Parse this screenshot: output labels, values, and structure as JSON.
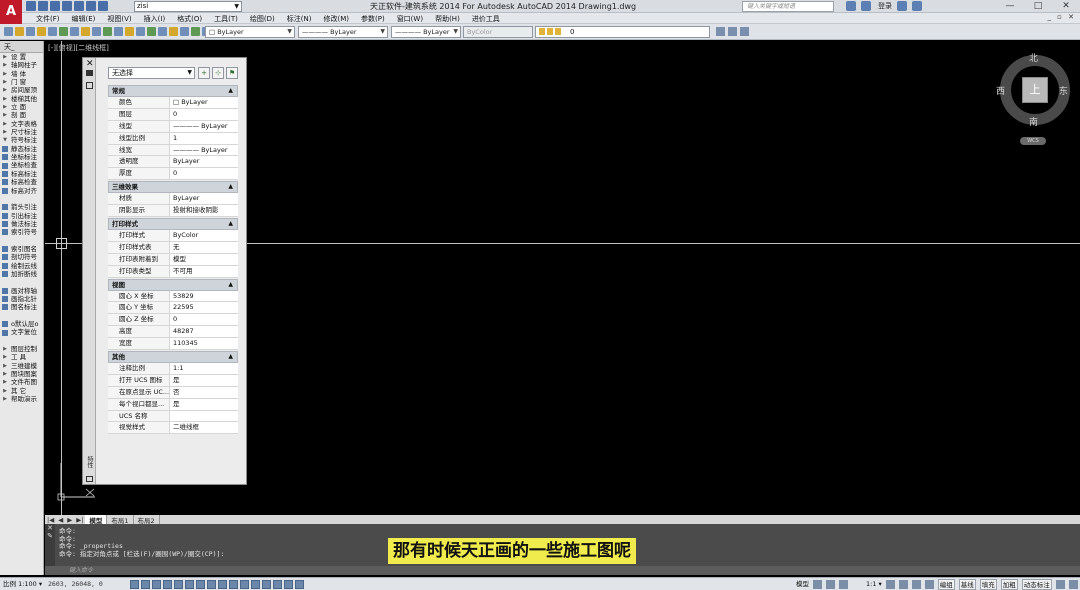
{
  "titlebar": {
    "app_logo": "A",
    "workspace": "zisi",
    "title": "天正软件-建筑系统 2014  For Autodesk AutoCAD 2014   Drawing1.dwg",
    "search_placeholder": "键入关键字或短语",
    "login": "登录",
    "window_controls": [
      "—",
      "□",
      "✕"
    ]
  },
  "menu": {
    "items": [
      "文件(F)",
      "编辑(E)",
      "视图(V)",
      "插入(I)",
      "格式(O)",
      "工具(T)",
      "绘图(D)",
      "标注(N)",
      "修改(M)",
      "参数(P)",
      "窗口(W)",
      "帮助(H)",
      "进价工具"
    ],
    "mdi_controls": "_ ▫ ✕"
  },
  "toolbar": {
    "color_combo": "□ ByLayer",
    "linetype_combo": "———— ByLayer",
    "lineweight_combo": "———— ByLayer",
    "plotstyle_combo": "ByColor",
    "layer_combo": "0"
  },
  "palette": {
    "title": "天_",
    "items": [
      {
        "label": "设    置",
        "type": "group"
      },
      {
        "label": "轴网柱子",
        "type": "group"
      },
      {
        "label": "墙    体",
        "type": "group"
      },
      {
        "label": "门    窗",
        "type": "group"
      },
      {
        "label": "房间屋顶",
        "type": "group"
      },
      {
        "label": "楼梯其他",
        "type": "group"
      },
      {
        "label": "立    面",
        "type": "group"
      },
      {
        "label": "剖    面",
        "type": "group"
      },
      {
        "label": "文字表格",
        "type": "group"
      },
      {
        "label": "尺寸标注",
        "type": "group"
      },
      {
        "label": "符号标注",
        "type": "open"
      },
      {
        "label": "静态标注",
        "type": "cmd"
      },
      {
        "label": "坐标标注",
        "type": "cmd"
      },
      {
        "label": "坐标检查",
        "type": "cmd"
      },
      {
        "label": "标高标注",
        "type": "cmd"
      },
      {
        "label": "标高检查",
        "type": "cmd"
      },
      {
        "label": "标高对齐",
        "type": "cmd"
      },
      {
        "label": "",
        "type": "spacer"
      },
      {
        "label": "箭头引注",
        "type": "cmd"
      },
      {
        "label": "引出标注",
        "type": "cmd"
      },
      {
        "label": "做法标注",
        "type": "cmd"
      },
      {
        "label": "索引符号",
        "type": "cmd"
      },
      {
        "label": "",
        "type": "spacer"
      },
      {
        "label": "索引图名",
        "type": "cmd"
      },
      {
        "label": "剖切符号",
        "type": "cmd"
      },
      {
        "label": "绘制云线",
        "type": "cmd"
      },
      {
        "label": "加折断线",
        "type": "cmd"
      },
      {
        "label": "",
        "type": "spacer"
      },
      {
        "label": "画对称轴",
        "type": "cmd"
      },
      {
        "label": "画指北针",
        "type": "cmd"
      },
      {
        "label": "图名标注",
        "type": "cmd"
      },
      {
        "label": "",
        "type": "spacer"
      },
      {
        "label": "o默认层o",
        "type": "cmd"
      },
      {
        "label": "文字复位",
        "type": "cmd"
      },
      {
        "label": "",
        "type": "spacer"
      },
      {
        "label": "图层控制",
        "type": "group"
      },
      {
        "label": "工    具",
        "type": "group"
      },
      {
        "label": "三维建模",
        "type": "group"
      },
      {
        "label": "图块图案",
        "type": "group"
      },
      {
        "label": "文件布图",
        "type": "group"
      },
      {
        "label": "其    它",
        "type": "group"
      },
      {
        "label": "帮助演示",
        "type": "group"
      }
    ]
  },
  "canvas": {
    "viewport_label": "[-][俯视][二维线框]",
    "viewcube": {
      "north": "北",
      "south": "南",
      "east": "东",
      "west": "西",
      "top": "上",
      "ucs": "WCS"
    }
  },
  "properties": {
    "selection": "无选择",
    "side_label": "特性",
    "categories": [
      {
        "name": "常规",
        "rows": [
          {
            "name": "颜色",
            "value": "□ ByLayer"
          },
          {
            "name": "图层",
            "value": "0"
          },
          {
            "name": "线型",
            "value": "———— ByLayer"
          },
          {
            "name": "线型比例",
            "value": "1"
          },
          {
            "name": "线宽",
            "value": "———— ByLayer"
          },
          {
            "name": "透明度",
            "value": "ByLayer"
          },
          {
            "name": "厚度",
            "value": "0"
          }
        ]
      },
      {
        "name": "三维效果",
        "rows": [
          {
            "name": "材质",
            "value": "ByLayer"
          },
          {
            "name": "阴影显示",
            "value": "投射和接收阴影"
          }
        ]
      },
      {
        "name": "打印样式",
        "rows": [
          {
            "name": "打印样式",
            "value": "ByColor"
          },
          {
            "name": "打印样式表",
            "value": "无"
          },
          {
            "name": "打印表附着到",
            "value": "模型"
          },
          {
            "name": "打印表类型",
            "value": "不可用"
          }
        ]
      },
      {
        "name": "视图",
        "rows": [
          {
            "name": "圆心 X 坐标",
            "value": "53829"
          },
          {
            "name": "圆心 Y 坐标",
            "value": "22595"
          },
          {
            "name": "圆心 Z 坐标",
            "value": "0"
          },
          {
            "name": "高度",
            "value": "48287"
          },
          {
            "name": "宽度",
            "value": "110345"
          }
        ]
      },
      {
        "name": "其他",
        "rows": [
          {
            "name": "注释比例",
            "value": "1:1"
          },
          {
            "name": "打开 UCS 图标",
            "value": "是"
          },
          {
            "name": "在原点显示 UC...",
            "value": "否"
          },
          {
            "name": "每个视口都显...",
            "value": "是"
          },
          {
            "name": "UCS 名称",
            "value": ""
          },
          {
            "name": "视觉样式",
            "value": "二维线框"
          }
        ]
      }
    ]
  },
  "tabs": {
    "nav": [
      "|◀",
      "◀",
      "▶",
      "▶|"
    ],
    "items": [
      "模型",
      "布局1",
      "布局2"
    ]
  },
  "command": {
    "lines": [
      "命令:",
      "命令:",
      "命令: _properties",
      "命令: 指定对角点或 [栏选(F)/圈围(WP)/圈交(CP)]:"
    ],
    "input_placeholder": "键入命令"
  },
  "subtitle": "那有时候天正画的一些施工图呢",
  "statusbar": {
    "scale": "比例 1:100 ▾",
    "coords": "2603,  26048,  0",
    "right_labels": [
      "模型",
      "1:1 ▾",
      "编组",
      "基线",
      "填充",
      "加粗",
      "动态标注"
    ]
  }
}
